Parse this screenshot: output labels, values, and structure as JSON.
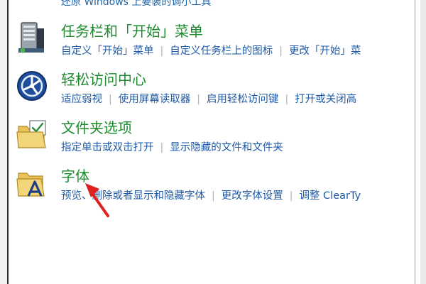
{
  "top_cut_text": "还原 Windows 上要装的调小工具",
  "categories": [
    {
      "title": "任务栏和「开始」菜单",
      "icon": "taskbar-icon",
      "links": [
        "自定义「开始」菜单",
        "自定义任务栏上的图标",
        "更改「开始」菜"
      ]
    },
    {
      "title": "轻松访问中心",
      "icon": "ease-of-access-icon",
      "links": [
        "适应弱视",
        "使用屏幕读取器",
        "启用轻松访问键",
        "打开或关闭高"
      ]
    },
    {
      "title": "文件夹选项",
      "icon": "folder-options-icon",
      "links": [
        "指定单击或双击打开",
        "显示隐藏的文件和文件夹"
      ]
    },
    {
      "title": "字体",
      "icon": "fonts-folder-icon",
      "links": [
        "预览、删除或者显示和隐藏字体",
        "更改字体设置",
        "调整 ClearTy"
      ]
    }
  ],
  "colors": {
    "title_green": "#1e8a2e",
    "link_blue": "#1e5aa8",
    "annotation_arrow": "#e02020"
  }
}
